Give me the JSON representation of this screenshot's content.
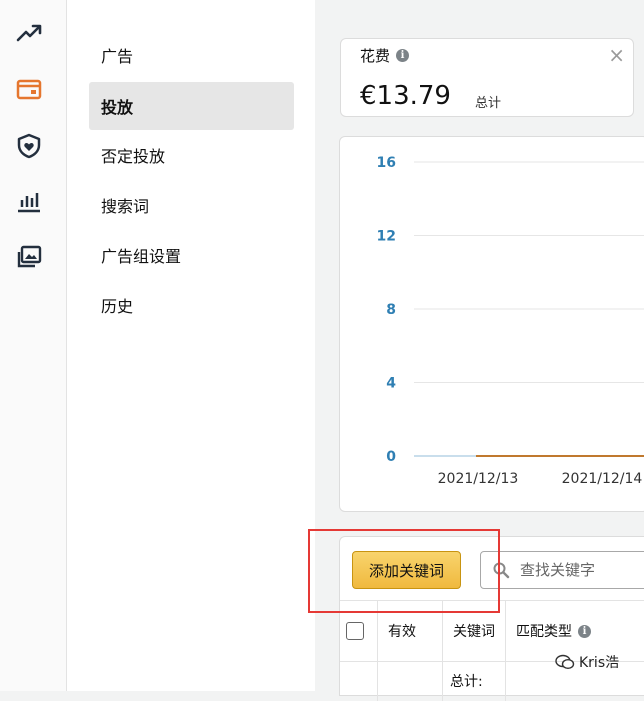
{
  "rail": {
    "icons": [
      "trend-icon",
      "campaign-card-icon",
      "shield-heart-icon",
      "bar-chart-icon",
      "image-gallery-icon"
    ],
    "active_index": 1,
    "accent": "#e5762e",
    "icon_color": "#232f3e"
  },
  "subnav": {
    "items": [
      {
        "label": "广告"
      },
      {
        "label": "投放"
      },
      {
        "label": "否定投放"
      },
      {
        "label": "搜索词"
      },
      {
        "label": "广告组设置"
      },
      {
        "label": "历史"
      }
    ],
    "active_index": 1
  },
  "metric": {
    "title": "花费",
    "info_icon": "i",
    "close_symbol": "×",
    "value": "€13.79",
    "sub": "总计"
  },
  "chart_data": {
    "type": "line",
    "yticks": [
      "16",
      "12",
      "8",
      "4",
      "0"
    ],
    "ylim": [
      0,
      16
    ],
    "x": [
      "2021/12/13",
      "2021/12/14"
    ],
    "series": [
      {
        "values": [
          0,
          0
        ],
        "color": "#c0792e"
      }
    ],
    "grid": true
  },
  "toolbar": {
    "add_keyword_label": "添加关键词",
    "search_placeholder": "查找关键字"
  },
  "table": {
    "headers": {
      "active": "有效",
      "keyword": "关键词",
      "match_type": "匹配类型"
    },
    "total_label": "总计:"
  },
  "watermark": {
    "text": "Kris浩"
  },
  "colors": {
    "highlight": "#e53935",
    "button": "#f0b93e",
    "tick": "#2f7fb3"
  }
}
